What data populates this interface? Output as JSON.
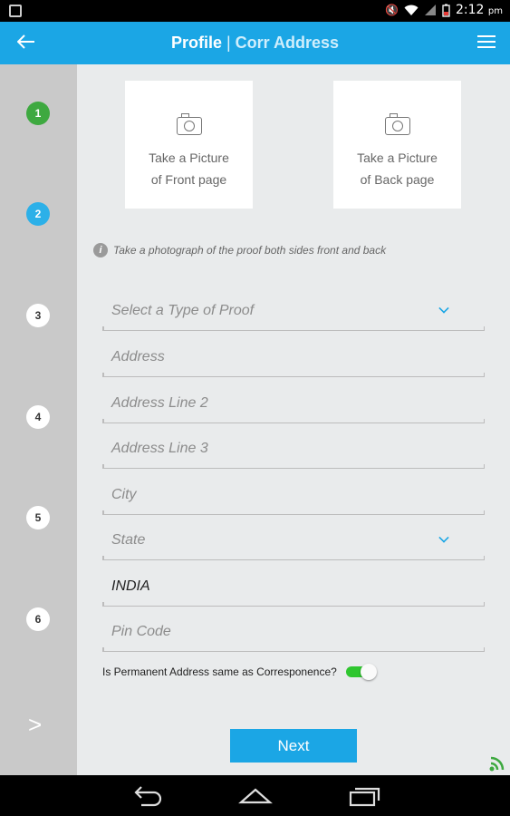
{
  "status_bar": {
    "time": "2:12",
    "ampm": "pm"
  },
  "app_bar": {
    "title": "Profile",
    "separator": "|",
    "subtitle": "Corr Address"
  },
  "steps": [
    "1",
    "2",
    "3",
    "4",
    "5",
    "6"
  ],
  "step_next": ">",
  "photo": {
    "front_label_1": "Take a Picture",
    "front_label_2": "of Front page",
    "back_label_1": "Take a Picture",
    "back_label_2": "of Back page",
    "hint_icon": "i",
    "hint": "Take a photograph of the proof both sides front and back"
  },
  "form": {
    "proof_type": "Select a Type of Proof",
    "address": "Address",
    "address2": "Address Line 2",
    "address3": "Address Line 3",
    "city": "City",
    "state": "State",
    "country": "INDIA",
    "pincode": "Pin Code",
    "permanent_same_question": "Is Permanent Address same as Corresponence?",
    "permanent_same": true
  },
  "next_button": "Next",
  "colors": {
    "accent": "#1ba6e5",
    "step_done": "#3ea940",
    "toggle_on": "#2fc62f"
  }
}
